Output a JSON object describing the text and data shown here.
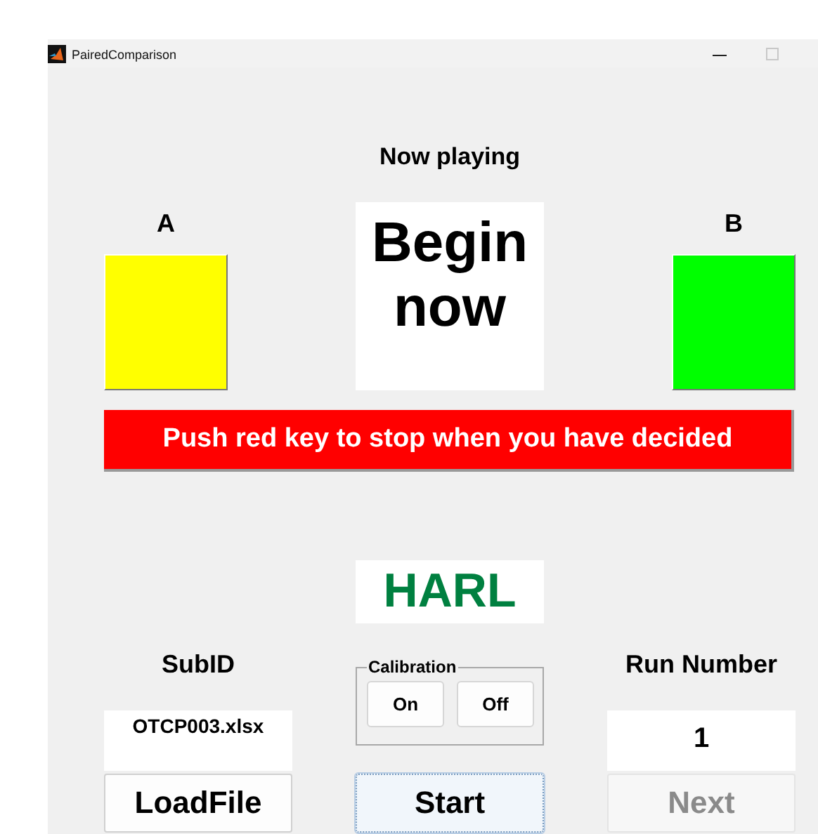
{
  "window": {
    "title": "PairedComparison"
  },
  "now_playing_label": "Now playing",
  "options": [
    {
      "label": "A",
      "color": "#ffff00"
    },
    {
      "label": "B",
      "color": "#00ff00"
    }
  ],
  "display": {
    "text": "Begin now"
  },
  "instruction": "Push red key to stop when you have decided",
  "condition": "HARL",
  "subid": {
    "label": "SubID",
    "value": "OTCP003.xlsx"
  },
  "calibration": {
    "title": "Calibration",
    "buttons": [
      {
        "label": "On"
      },
      {
        "label": "Off"
      }
    ]
  },
  "run_number": {
    "label": "Run Number",
    "value": "1"
  },
  "buttons": [
    {
      "label": "LoadFile",
      "focused": false,
      "disabled": false
    },
    {
      "label": "Start",
      "focused": true,
      "disabled": false
    },
    {
      "label": "Next",
      "focused": false,
      "disabled": true
    }
  ]
}
